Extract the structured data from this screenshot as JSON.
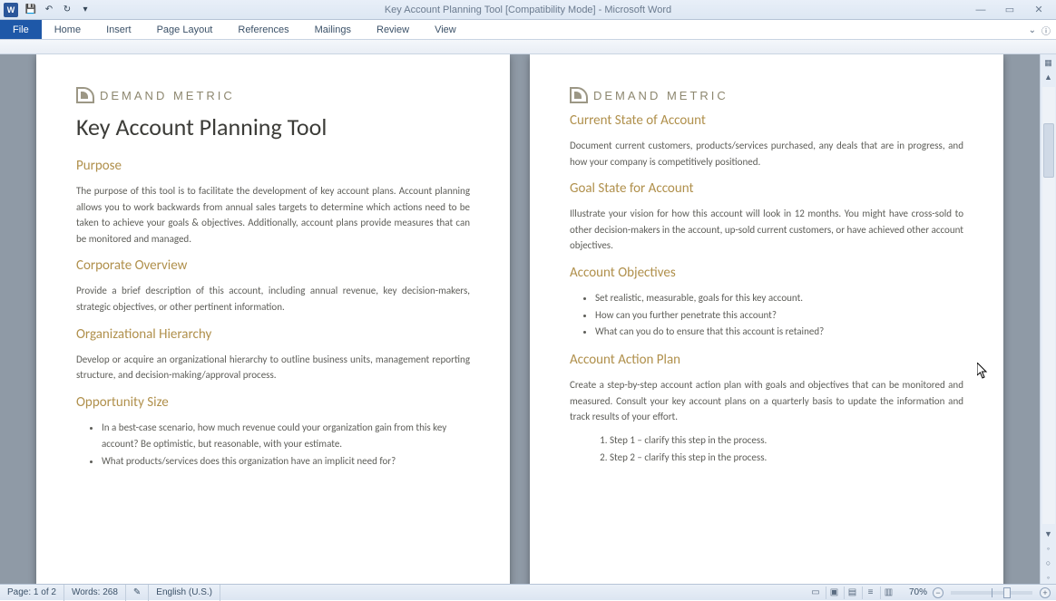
{
  "title": "Key Account Planning Tool [Compatibility Mode] - Microsoft Word",
  "ribbon": {
    "file": "File",
    "tabs": [
      "Home",
      "Insert",
      "Page Layout",
      "References",
      "Mailings",
      "Review",
      "View"
    ]
  },
  "brand": "DEMAND METRIC",
  "page1": {
    "title": "Key Account Planning Tool",
    "h_purpose": "Purpose",
    "p_purpose": "The purpose of this tool is to facilitate the development of key account plans.  Account planning allows you to work backwards from annual sales targets to determine which actions need to be taken to achieve your goals & objectives.  Additionally, account plans provide measures that can be monitored and managed.",
    "h_corp": "Corporate Overview",
    "p_corp": "Provide a brief description of this account, including annual revenue, key decision-makers, strategic objectives, or other pertinent information.",
    "h_org": "Organizational Hierarchy",
    "p_org": "Develop or acquire an organizational hierarchy to outline business units, management reporting structure, and decision-making/approval process.",
    "h_opp": "Opportunity Size",
    "opp_b1": "In a best-case scenario, how much revenue could your organization gain from this key account?  Be optimistic, but reasonable, with your estimate.",
    "opp_b2": "What products/services does this organization have an implicit need for?"
  },
  "page2": {
    "h_current": "Current State of Account",
    "p_current": "Document current customers, products/services purchased, any deals that are in progress, and how your company is competitively positioned.",
    "h_goal": "Goal State for Account",
    "p_goal": "Illustrate your vision for how this account will look in 12 months.   You might have cross-sold to other decision-makers in the account, up-sold current customers, or have achieved other account objectives.",
    "h_obj": "Account Objectives",
    "obj_b1": "Set realistic, measurable, goals for this key account.",
    "obj_b2": "How can you further penetrate this account?",
    "obj_b3": "What can you do to ensure that this account is retained?",
    "h_plan": "Account Action Plan",
    "p_plan": "Create a step-by-step account action plan with goals and objectives that can be monitored and measured.  Consult your key account plans on a quarterly basis to update the information and track results of your effort.",
    "step1": "Step 1 – clarify this step in the process.",
    "step2": "Step 2 – clarify this step in the process."
  },
  "status": {
    "page": "Page: 1 of 2",
    "words": "Words: 268",
    "lang": "English (U.S.)",
    "zoom": "70%"
  }
}
